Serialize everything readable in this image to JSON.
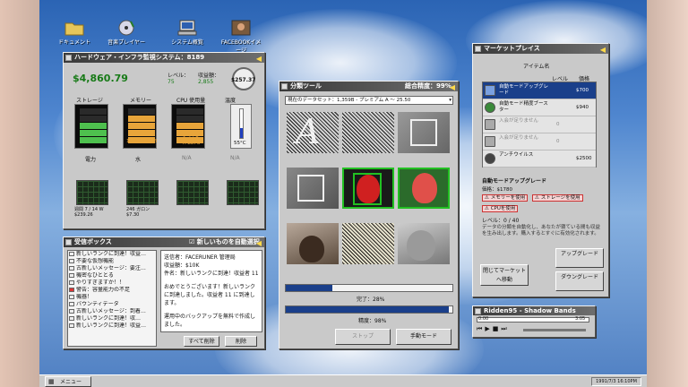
{
  "desktop": {
    "icons": [
      {
        "label": "ドキュメント",
        "icon": "folder-icon"
      },
      {
        "label": "音楽プレイヤー",
        "icon": "cd-icon"
      },
      {
        "label": "システム概覧",
        "icon": "computer-icon"
      },
      {
        "label": "FACEBOOKイメージ",
        "icon": "photo-icon"
      }
    ]
  },
  "hw": {
    "title": "ハードウェア・インフラ監視システム：8189",
    "balance": "$4,860.79",
    "level_label": "レベル：",
    "level_value": "75",
    "income_label": "収益額：",
    "income_value": "2,855",
    "rate": "$257.37",
    "cols": [
      {
        "label": "ストレージ",
        "value": "4.2 / 8 GB",
        "level": 0.5
      },
      {
        "label": "メモリー",
        "value": "15.4 / 16 GB",
        "level": 0.85
      },
      {
        "label": "CPU 使用量",
        "value": "5.2 / 8 TFLOPS",
        "level": 0.65
      },
      {
        "label": "温度",
        "value": "55°C",
        "level": 0.35
      }
    ],
    "net": [
      {
        "label": "電力",
        "value": "週間 7 / 14 W\n$239.26"
      },
      {
        "label": "水",
        "value": "246 ガロン\n$7.30"
      },
      {
        "label": "N/A",
        "value": ""
      },
      {
        "label": "N/A",
        "value": ""
      }
    ]
  },
  "inbox": {
    "title": "受信ボックス",
    "checkbox": "新しいものを自動選択",
    "items": [
      "新しいランクに到達！収益…",
      "不要な仮想機能",
      "古新しいメッセージ：要注…",
      "機密なひととる",
      "やりすぎますか！！",
      "警告：容量能力の不足",
      "機器！",
      "バウンティデータ",
      "古新しいメッセージ：到着…",
      "新しいランクに到達！収…",
      "新しいランクに到達！収益…"
    ],
    "msg": {
      "from": "送信者：FACERUNER 管理局",
      "exp": "収益額：$10K",
      "subject": "件名：新しいランクに到達！収益者 11",
      "body": "おめでとうございます！新しいランクに到達しました。収益者 11 に到達します。",
      "body2": "運用中のバックアップを無料で作成しました。"
    },
    "btn_all": "すべて削除",
    "btn_del": "削除"
  },
  "scan": {
    "title": "分類ツール",
    "meta": "総合精度：99%",
    "dataset": "現在のデータセット：1,359B - プレミアム A ～ 25.50",
    "progress1": {
      "label": "完了：28%",
      "value": 0.28
    },
    "progress2": {
      "label": "精度：98%",
      "value": 0.98
    },
    "btn_stop": "ストップ",
    "btn_manual": "手動モード"
  },
  "market": {
    "title": "マーケットプレイス",
    "header_item": "アイテム名",
    "header_lvl": "レベル",
    "header_price": "価格",
    "items": [
      {
        "name": "自動モードアップグレード",
        "lvl": "",
        "price": "$700",
        "icon": "magnifier-icon",
        "selected": true
      },
      {
        "name": "自動モード精度ブースター",
        "lvl": "",
        "price": "$940",
        "icon": "globe-icon"
      },
      {
        "name": "入会が足りません",
        "lvl": "0",
        "price": "",
        "icon": "lock-icon"
      },
      {
        "name": "入会が足りません",
        "lvl": "0",
        "price": "",
        "icon": "lock-icon"
      },
      {
        "name": "アンチウイルス",
        "lvl": "",
        "price": "$2500",
        "icon": "gear-icon"
      }
    ],
    "detail_title": "自動モードアップグレード",
    "detail_sub": "価格：$1780",
    "tags": [
      "メモリーを使用",
      "ストレージを使用",
      "CPUを使用"
    ],
    "level": "レベル：0 / 40",
    "desc": "データの分類を自動化し、あなたが寝ている間も収益を生み出します。購入するとすぐに有効化されます。",
    "btn_close": "閉じてマーケット へ移動",
    "btn_up": "アップグレード",
    "btn_down": "ダウングレード"
  },
  "music": {
    "title": "Ridden95 - Shadow Bands",
    "time_start": "0:00",
    "time_end": "3:05"
  },
  "taskbar": {
    "start": "メニュー",
    "clock": "1991/7/3 16:10PM"
  },
  "colors": {
    "accent": "#1a3f8a",
    "titlebar": "#3a3a3a"
  }
}
